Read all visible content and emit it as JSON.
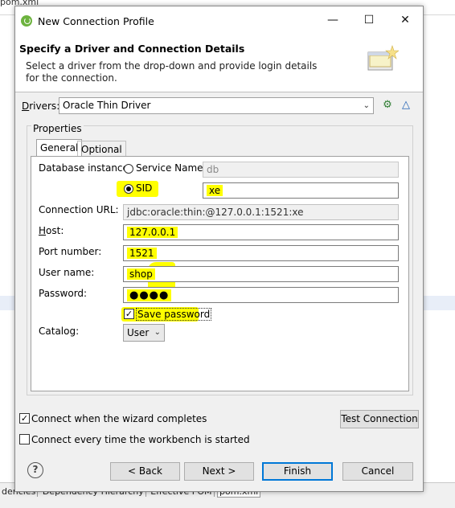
{
  "background": {
    "top_tab": "pom.xml",
    "bottom_tabs": [
      "dencies",
      "Dependency Hierarchy",
      "Effective POM",
      "pom.xml"
    ]
  },
  "window": {
    "title": "New Connection Profile",
    "controls": {
      "minimize": "—",
      "maximize": "☐",
      "close": "✕"
    }
  },
  "header": {
    "title": "Specify a Driver and Connection Details",
    "description": "Select a driver from the drop-down and provide login details for the connection."
  },
  "drivers": {
    "label": "Drivers:",
    "selected": "Oracle Thin Driver"
  },
  "properties": {
    "group_label": "Properties",
    "tabs": [
      "General",
      "Optional"
    ],
    "database_instance_label": "Database instance:",
    "service_name_label": "Service Name",
    "service_name_value": "db",
    "sid_label": "SID",
    "sid_value": "xe",
    "connection_url_label": "Connection URL:",
    "connection_url_value": "jdbc:oracle:thin:@127.0.0.1:1521:xe",
    "host_label": "Host:",
    "host_value": "127.0.0.1",
    "port_label": "Port number:",
    "port_value": "1521",
    "user_label": "User name:",
    "user_value": "shop",
    "password_label": "Password:",
    "password_value": "●●●●",
    "save_password_label": "Save password",
    "catalog_label": "Catalog:",
    "catalog_value": "User"
  },
  "options": {
    "connect_when_completes": "Connect when the wizard completes",
    "connect_every_time": "Connect every time the workbench is started",
    "test_connection": "Test Connection"
  },
  "buttons": {
    "back": "< Back",
    "next": "Next >",
    "finish": "Finish",
    "cancel": "Cancel"
  },
  "colors": {
    "highlight": "#ffff00",
    "default_button_border": "#0078d7",
    "dialog_bg": "#f0f0f0"
  }
}
